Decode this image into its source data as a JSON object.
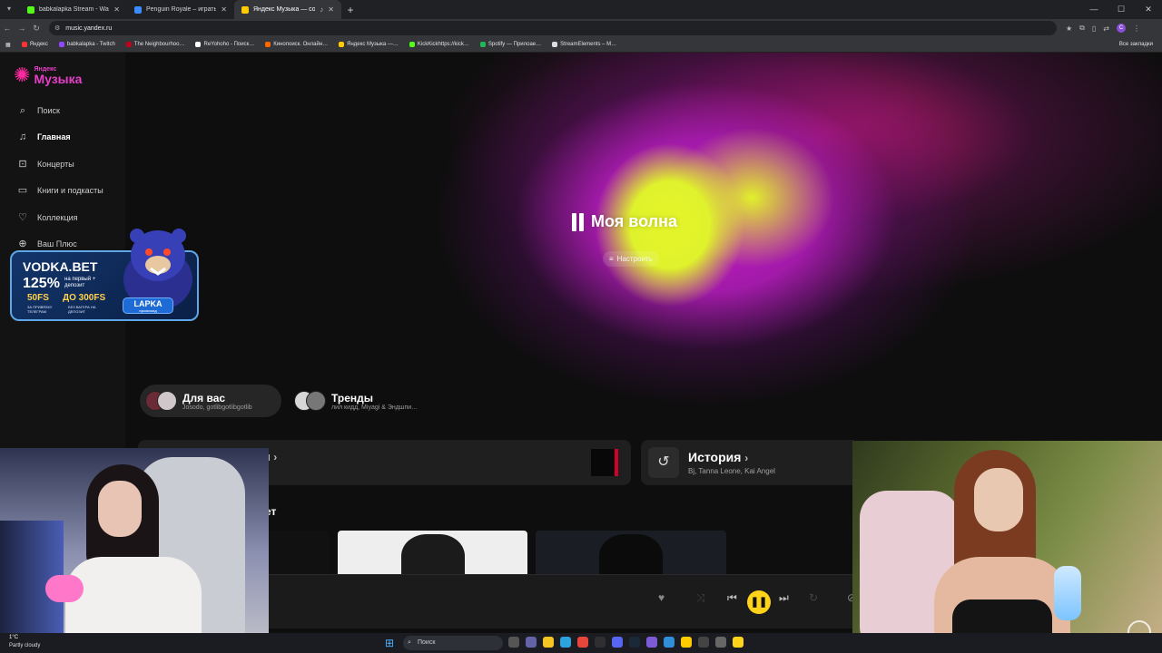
{
  "browser": {
    "tabs": [
      {
        "title": "babkalapka Stream - Watch Li…",
        "color": "#53fc18",
        "active": false
      },
      {
        "title": "Penguin Royale – играть на о…",
        "color": "#3a8bff",
        "active": false
      },
      {
        "title": "Яндекс Музыка — собира…",
        "color": "#ffcc00",
        "active": true
      }
    ],
    "new_tab": "+",
    "url": "music.yandex.ru",
    "profile_letter": "C",
    "bookmarks": [
      {
        "label": "Яндекс",
        "color": "#ff3333"
      },
      {
        "label": "babkalapka - Twitch",
        "color": "#9146ff"
      },
      {
        "label": "The Neighbourhoo…",
        "color": "#c4001a"
      },
      {
        "label": "ReYohoho - Поиск…",
        "color": "#ffffff"
      },
      {
        "label": "Кинопоиск. Онлайн…",
        "color": "#ff6600"
      },
      {
        "label": "Яндекс Музыка —…",
        "color": "#ffcc00"
      },
      {
        "label": "KickKickhttps://kick…",
        "color": "#53fc18"
      },
      {
        "label": "Spotify — Прилоae…",
        "color": "#1db954"
      },
      {
        "label": "StreamElements – M…",
        "color": "#dddddd"
      }
    ],
    "all_bookmarks": "Все закладки"
  },
  "sidebar": {
    "logo_small": "Яндекс",
    "logo_big": "Музыка",
    "items": [
      {
        "label": "Поиск",
        "icon": "search-icon",
        "glyph": "⌕"
      },
      {
        "label": "Главная",
        "icon": "note-icon",
        "glyph": "♫"
      },
      {
        "label": "Концерты",
        "icon": "ticket-icon",
        "glyph": "⊡"
      },
      {
        "label": "Книги и подкасты",
        "icon": "book-icon",
        "glyph": "▭"
      },
      {
        "label": "Коллекция",
        "icon": "heart-icon",
        "glyph": "♡"
      },
      {
        "label": "Ваш Плюс",
        "icon": "plus-icon",
        "glyph": "⊕"
      }
    ]
  },
  "hero": {
    "title": "Моя волна",
    "tune_label": "Настроить"
  },
  "chips": [
    {
      "title": "Для вас",
      "subtitle": "Josodo, gotlibgotlibgotlib"
    },
    {
      "title": "Тренды",
      "subtitle": "лил кидд, Miyagi & Эндшпи…"
    }
  ],
  "cards": {
    "partial_label": "я",
    "history_title": "История",
    "history_subtitle": "Bj, Tanna Leone, Kai Angel"
  },
  "section_partial": "ет",
  "promo": {
    "brand": "VODKA.BET",
    "percent": "125%",
    "percent_sub": "на первый + депозит",
    "fs1": "50FS",
    "fs1_sub": "ЗА ПРИВЯЗКУ ТЕЛЕГРАМ",
    "fs2": "ДО 300FS",
    "fs2_sub": "БЕЗ ВАГЕРА НА ДЕПОЗИТ",
    "code": "LAPKA",
    "code_sub": "промокод"
  },
  "taskbar": {
    "temp": "1°C",
    "weather": "Partly cloudy",
    "search": "Поиск"
  }
}
